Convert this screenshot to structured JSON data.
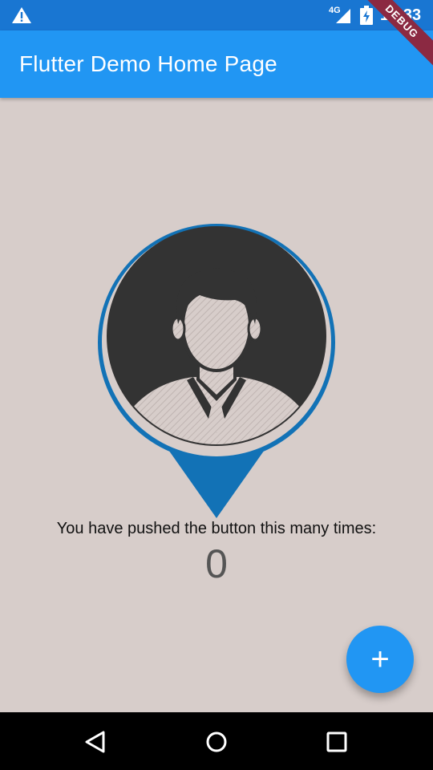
{
  "status_bar": {
    "network": "4G",
    "time": "10:33",
    "icons": [
      "warning-icon",
      "signal-icon",
      "battery-charging-icon"
    ]
  },
  "app_bar": {
    "title": "Flutter Demo Home Page",
    "color": "#2196f3"
  },
  "debug_banner": "DEBUG",
  "avatar": {
    "icon": "user-location-pin-icon",
    "pin_color": "#1272b6",
    "face_color": "#333333"
  },
  "counter": {
    "label": "You have pushed the button this many times:",
    "value": "0"
  },
  "fab": {
    "icon": "plus-icon",
    "label": "+"
  },
  "nav_bar": {
    "buttons": [
      "back-icon",
      "home-icon",
      "recents-icon"
    ]
  }
}
